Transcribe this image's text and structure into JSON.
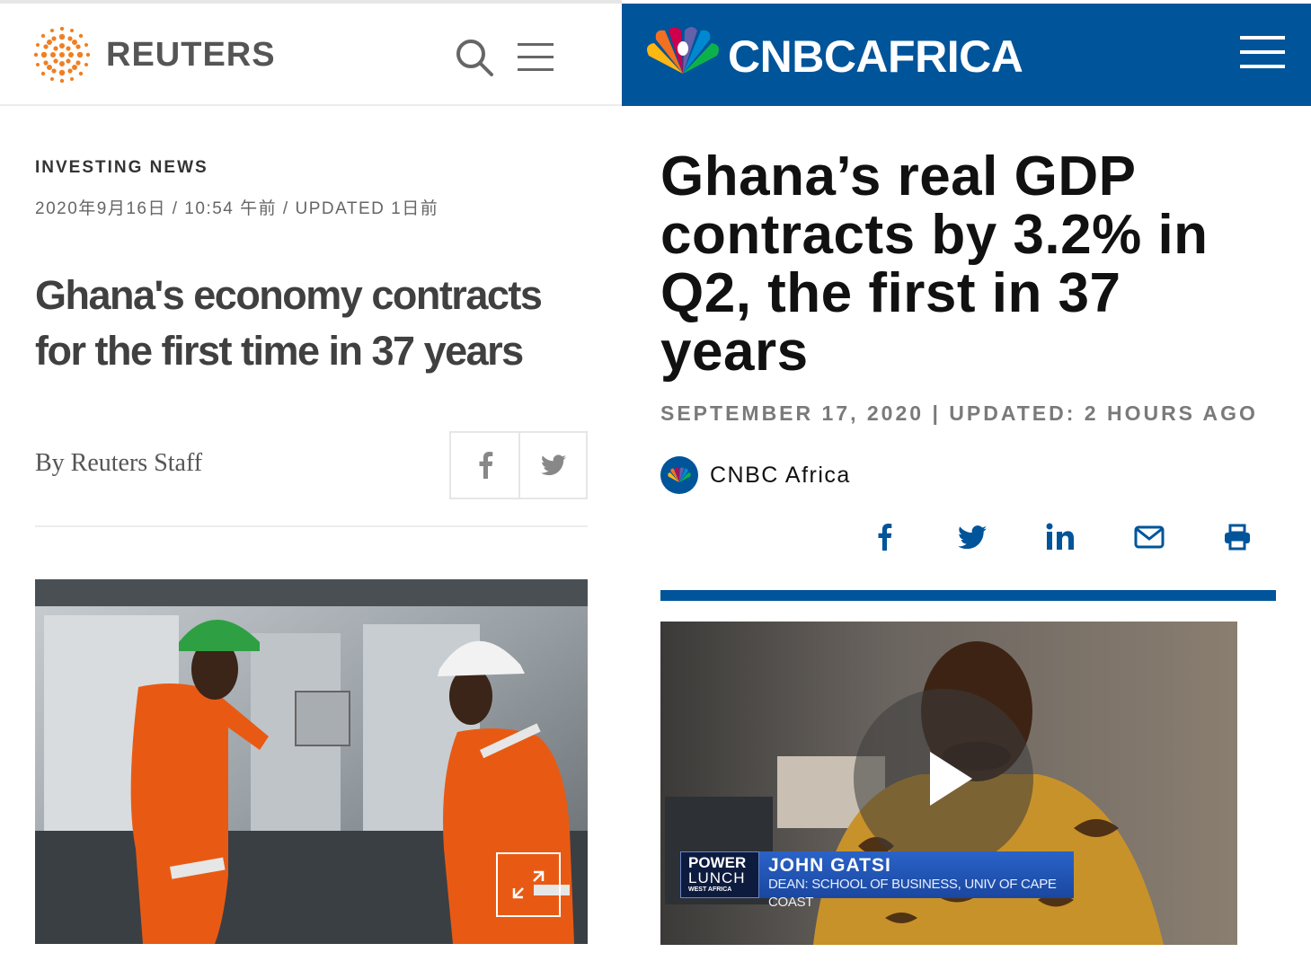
{
  "reuters": {
    "brand": "REUTERS",
    "section": "INVESTING NEWS",
    "dateline": "2020年9月16日 / 10:54 午前 / UPDATED 1日前",
    "headline": "Ghana's economy contracts for the first time in 37 years",
    "byline": "By Reuters Staff",
    "icons": {
      "logo": "reuters-dotted-logo",
      "search": "search-icon",
      "menu": "hamburger-menu-icon",
      "facebook": "facebook-icon",
      "twitter": "twitter-icon",
      "expand": "expand-icon"
    }
  },
  "cnbc": {
    "brand": "CNBCAFRICA",
    "headline": "Ghana’s real GDP contracts by 3.2% in Q2, the first in 37 years",
    "dateline": "SEPTEMBER 17, 2020 | UPDATED: 2 HOURS AGO",
    "author": "CNBC Africa",
    "video": {
      "show_line1": "POWER",
      "show_line2": "LUNCH",
      "show_line3": "WEST AFRICA",
      "guest_name": "JOHN GATSI",
      "guest_title": "DEAN: SCHOOL OF BUSINESS, UNIV OF CAPE COAST"
    },
    "icons": {
      "logo": "nbc-peacock-icon",
      "menu": "hamburger-menu-icon",
      "share": [
        "facebook-icon",
        "twitter-icon",
        "linkedin-icon",
        "email-icon",
        "print-icon"
      ],
      "play": "play-icon"
    }
  },
  "colors": {
    "cnbc_blue": "#00549a",
    "reuters_orange": "#f07f22",
    "reuters_gray_text": "#555555"
  }
}
